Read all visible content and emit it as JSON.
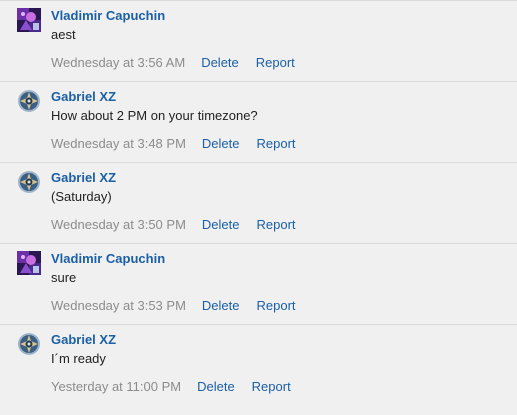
{
  "messages": [
    {
      "author": "Vladimir Capuchin",
      "avatar": "purple-art-avatar",
      "text": "aest",
      "time": "Wednesday at 3:56 AM",
      "delete_label": "Delete",
      "report_label": "Report"
    },
    {
      "author": "Gabriel XZ",
      "avatar": "blue-gear-avatar",
      "text": "How about 2 PM on your timezone?",
      "time": "Wednesday at 3:48 PM",
      "delete_label": "Delete",
      "report_label": "Report"
    },
    {
      "author": "Gabriel XZ",
      "avatar": "blue-gear-avatar",
      "text": "(Saturday)",
      "time": "Wednesday at 3:50 PM",
      "delete_label": "Delete",
      "report_label": "Report"
    },
    {
      "author": "Vladimir Capuchin",
      "avatar": "purple-art-avatar",
      "text": "sure",
      "time": "Wednesday at 3:53 PM",
      "delete_label": "Delete",
      "report_label": "Report"
    },
    {
      "author": "Gabriel XZ",
      "avatar": "blue-gear-avatar",
      "text": "I´m ready",
      "time": "Yesterday at 11:00 PM",
      "delete_label": "Delete",
      "report_label": "Report"
    }
  ],
  "colors": {
    "author_link": "#1b5fa6",
    "action_link": "#1b5fa6",
    "timestamp": "#8c8c8c",
    "body_text": "#222222",
    "background": "#f0f0f0",
    "divider": "#dadada"
  }
}
